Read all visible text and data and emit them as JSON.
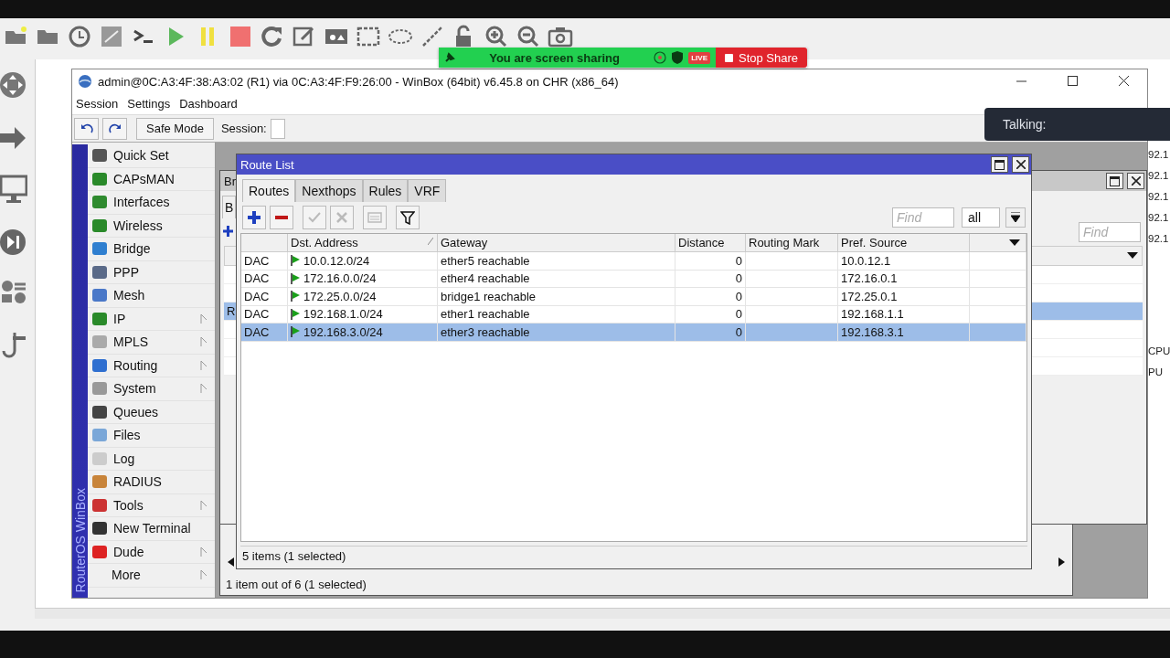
{
  "background_app": {
    "side_texts": [
      "92.1",
      "92.1",
      "92.1",
      "92.1",
      "92.1",
      "CPU",
      "PU"
    ]
  },
  "winbox": {
    "title": "admin@0C:A3:4F:38:A3:02 (R1) via 0C:A3:4F:F9:26:00 - WinBox (64bit) v6.45.8 on CHR (x86_64)",
    "menu": [
      "Session",
      "Settings",
      "Dashboard"
    ],
    "safe_mode": "Safe Mode",
    "session_label": "Session:",
    "brand": "RouterOS WinBox",
    "sidebar": [
      {
        "label": "Quick Set",
        "has_icon": true,
        "submenu": false
      },
      {
        "label": "CAPsMAN",
        "has_icon": true,
        "submenu": false
      },
      {
        "label": "Interfaces",
        "has_icon": true,
        "submenu": false
      },
      {
        "label": "Wireless",
        "has_icon": true,
        "submenu": false
      },
      {
        "label": "Bridge",
        "has_icon": true,
        "submenu": false
      },
      {
        "label": "PPP",
        "has_icon": true,
        "submenu": false
      },
      {
        "label": "Mesh",
        "has_icon": true,
        "submenu": false
      },
      {
        "label": "IP",
        "has_icon": true,
        "submenu": true
      },
      {
        "label": "MPLS",
        "has_icon": true,
        "submenu": true
      },
      {
        "label": "Routing",
        "has_icon": true,
        "submenu": true
      },
      {
        "label": "System",
        "has_icon": true,
        "submenu": true
      },
      {
        "label": "Queues",
        "has_icon": true,
        "submenu": false
      },
      {
        "label": "Files",
        "has_icon": true,
        "submenu": false
      },
      {
        "label": "Log",
        "has_icon": true,
        "submenu": false
      },
      {
        "label": "RADIUS",
        "has_icon": true,
        "submenu": false
      },
      {
        "label": "Tools",
        "has_icon": true,
        "submenu": true
      },
      {
        "label": "New Terminal",
        "has_icon": true,
        "submenu": false
      },
      {
        "label": "Dude",
        "has_icon": true,
        "submenu": true
      },
      {
        "label": "More",
        "has_icon": false,
        "submenu": true
      }
    ]
  },
  "back_window": {
    "status": "1 item out of 6 (1 selected)"
  },
  "bridge_window": {
    "title": "Br",
    "tab": "B",
    "row_flag": "R",
    "row_selected": true,
    "find_placeholder": "Find"
  },
  "route_list": {
    "title": "Route List",
    "tabs": [
      {
        "label": "Routes",
        "selected": true
      },
      {
        "label": "Nexthops",
        "selected": false
      },
      {
        "label": "Rules",
        "selected": false
      },
      {
        "label": "VRF",
        "selected": false
      }
    ],
    "tools": [
      {
        "kind": "add",
        "disabled": false
      },
      {
        "kind": "remove",
        "disabled": false
      },
      {
        "kind": "enable",
        "disabled": true
      },
      {
        "kind": "disable",
        "disabled": true
      },
      {
        "kind": "comment",
        "disabled": true
      },
      {
        "kind": "filter",
        "disabled": false
      }
    ],
    "find_placeholder": "Find",
    "filter_value": "all",
    "columns": [
      {
        "label": "Dst. Address",
        "sorted": true
      },
      {
        "label": "Gateway",
        "sorted": false
      },
      {
        "label": "Distance",
        "sorted": false
      },
      {
        "label": "Routing Mark",
        "sorted": false
      },
      {
        "label": "Pref. Source",
        "sorted": false
      }
    ],
    "rows": [
      {
        "flags": "DAC",
        "active": true,
        "dst": "10.0.12.0/24",
        "gateway": "ether5 reachable",
        "distance": "0",
        "pref_source": "10.0.12.1",
        "selected": false
      },
      {
        "flags": "DAC",
        "active": true,
        "dst": "172.16.0.0/24",
        "gateway": "ether4 reachable",
        "distance": "0",
        "pref_source": "172.16.0.1",
        "selected": false
      },
      {
        "flags": "DAC",
        "active": true,
        "dst": "172.25.0.0/24",
        "gateway": "bridge1 reachable",
        "distance": "0",
        "pref_source": "172.25.0.1",
        "selected": false
      },
      {
        "flags": "DAC",
        "active": true,
        "dst": "192.168.1.0/24",
        "gateway": "ether1 reachable",
        "distance": "0",
        "pref_source": "192.168.1.1",
        "selected": false
      },
      {
        "flags": "DAC",
        "active": true,
        "dst": "192.168.3.0/24",
        "gateway": "ether3 reachable",
        "distance": "0",
        "pref_source": "192.168.3.1",
        "selected": true
      }
    ],
    "status": "5 items (1 selected)"
  },
  "zoom": {
    "sharing": "You are screen sharing",
    "live": "LIVE",
    "stop": "Stop Share",
    "talking": "Talking:"
  }
}
